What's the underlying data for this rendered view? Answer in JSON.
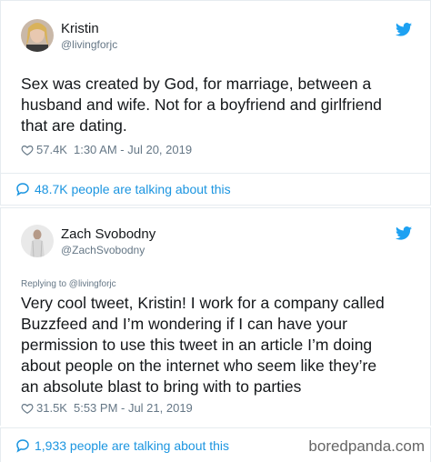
{
  "tweet1": {
    "name": "Kristin",
    "handle": "@livingforjc",
    "text_lines": [
      "Sex was created by God, for marriage, between a",
      "husband and wife. Not for a boyfriend and girlfriend",
      "that are dating."
    ],
    "likes": "57.4K",
    "timestamp": "1:30 AM - Jul 20, 2019",
    "talking": "48.7K people are talking about this"
  },
  "tweet2": {
    "name": "Zach Svobodny",
    "handle": "@ZachSvobodny",
    "replying_to": "Replying to @livingforjc",
    "text_lines": [
      "Very cool tweet, Kristin! I work for a company called",
      "Buzzfeed and I’m wondering if I can have your",
      "permission to use this tweet in an article I’m doing",
      "about people on the internet who seem like they’re",
      "an absolute blast to bring with to parties"
    ],
    "likes": "31.5K",
    "timestamp": "5:53 PM - Jul 21, 2019",
    "talking": "1,933 people are talking about this"
  },
  "watermark": "boredpanda.com",
  "colors": {
    "twitter_blue": "#1da1f2",
    "link_blue": "#1b95e0",
    "secondary_text": "#657786",
    "border": "#e6ecf0"
  },
  "icons": [
    "twitter-bird-icon",
    "heart-icon",
    "speech-bubble-icon"
  ]
}
